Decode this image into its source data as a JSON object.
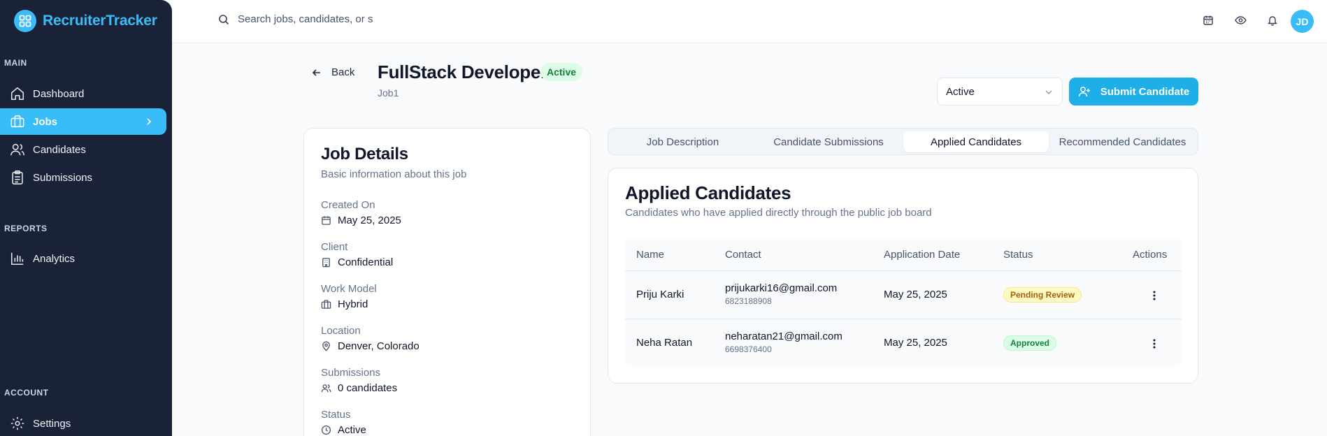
{
  "app": {
    "name": "RecruiterTracker"
  },
  "sidebar": {
    "sections": {
      "main": "MAIN",
      "reports": "REPORTS",
      "account": "ACCOUNT"
    },
    "items": [
      {
        "label": "Dashboard",
        "icon": "home-icon"
      },
      {
        "label": "Jobs",
        "icon": "briefcase-icon",
        "active": true
      },
      {
        "label": "Candidates",
        "icon": "users-icon"
      },
      {
        "label": "Submissions",
        "icon": "clipboard-icon"
      },
      {
        "label": "Analytics",
        "icon": "bar-chart-icon"
      },
      {
        "label": "Settings",
        "icon": "gear-icon"
      }
    ]
  },
  "topbar": {
    "search_placeholder": "Search jobs, candidates, or s",
    "icons": [
      "calendar-icon",
      "eye-icon",
      "bell-icon"
    ],
    "avatar_initials": "JD"
  },
  "header": {
    "back_label": "Back",
    "title": "FullStack Developer",
    "title_badge": "Active",
    "subtitle": "Job1",
    "status_select": "Active",
    "submit_label": "Submit Candidate"
  },
  "details": {
    "title": "Job Details",
    "description": "Basic information about this job",
    "fields": [
      {
        "label": "Created On",
        "value": "May 25, 2025",
        "icon": "calendar-icon"
      },
      {
        "label": "Client",
        "value": "Confidential",
        "icon": "building-icon"
      },
      {
        "label": "Work Model",
        "value": "Hybrid",
        "icon": "briefcase-icon"
      },
      {
        "label": "Location",
        "value": "Denver, Colorado",
        "icon": "map-pin-icon"
      },
      {
        "label": "Submissions",
        "value": "0 candidates",
        "icon": "users-icon"
      },
      {
        "label": "Status",
        "value": "Active",
        "icon": "clock-icon"
      }
    ]
  },
  "tabs": [
    {
      "label": "Job Description"
    },
    {
      "label": "Candidate Submissions"
    },
    {
      "label": "Applied Candidates",
      "active": true
    },
    {
      "label": "Recommended Candidates"
    }
  ],
  "applied": {
    "title": "Applied Candidates",
    "description": "Candidates who have applied directly through the public job board",
    "columns": [
      "Name",
      "Contact",
      "Application Date",
      "Status",
      "Actions"
    ],
    "rows": [
      {
        "name": "Priju Karki",
        "email": "prijukarki16@gmail.com",
        "phone": "6823188908",
        "date": "May 25, 2025",
        "status": "Pending Review",
        "status_kind": "pending"
      },
      {
        "name": "Neha Ratan",
        "email": "neharatan21@gmail.com",
        "phone": "6698376400",
        "date": "May 25, 2025",
        "status": "Approved",
        "status_kind": "approved"
      }
    ]
  },
  "colors": {
    "accent": "#38bdf8",
    "sidebar_bg": "#1a2238",
    "pending": "#a16207",
    "approved": "#15803d"
  }
}
